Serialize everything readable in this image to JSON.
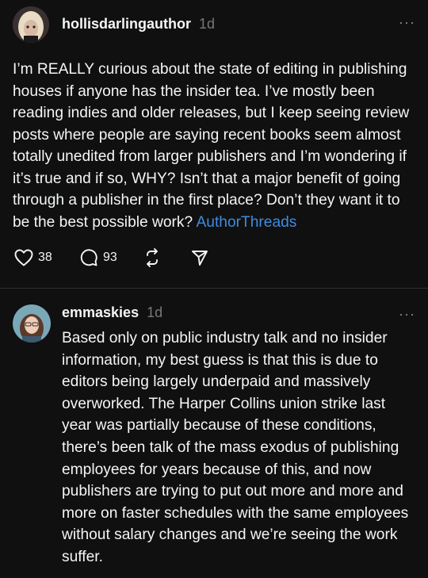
{
  "post": {
    "username": "hollisdarlingauthor",
    "time": "1d",
    "more": "···",
    "text": "I’m REALLY curious about the state of editing in publishing houses if anyone has the insider tea. I’ve mostly been reading indies and older releases, but I keep seeing review posts where people are saying recent books seem almost totally unedited from larger publishers and I’m wondering if it’s true and if so, WHY? Isn’t that a major benefit of going through a publisher in the first place? Don’t they want it to be the best possible work?",
    "hashtag": "AuthorThreads",
    "likes": "38",
    "replies": "93",
    "icons": {
      "like": "heart-icon",
      "reply": "comment-icon",
      "repost": "repost-icon",
      "share": "send-icon"
    }
  },
  "reply": {
    "username": "emmaskies",
    "time": "1d",
    "more": "···",
    "text": "Based only on public industry talk and no insider information, my best guess is that this is due to editors being largely underpaid and massively overworked. The Harper Collins union strike last year was partially because of these conditions, there’s been talk of the mass exodus of publishing employees for years because of this, and now publishers are trying to put out more and more and more on faster schedules with the same employees without salary changes and we’re seeing the work suffer."
  },
  "colors": {
    "background": "#101010",
    "text": "#f3f5f7",
    "muted": "#777777",
    "link": "#3f8bdf"
  }
}
